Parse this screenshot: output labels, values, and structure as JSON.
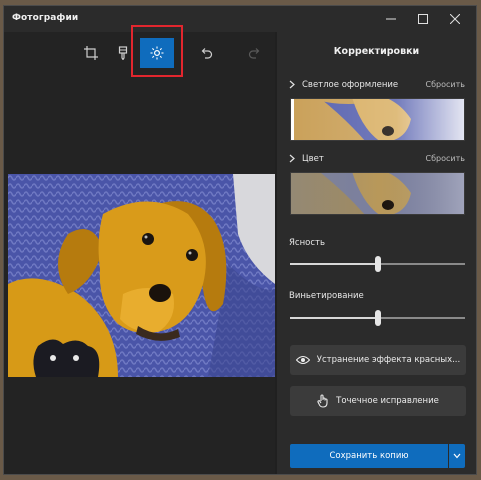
{
  "window": {
    "title": "Фотографии"
  },
  "toolbar": {
    "tools": [
      {
        "name": "crop-icon"
      },
      {
        "name": "filter-brush-icon"
      },
      {
        "name": "brightness-icon",
        "active": true
      },
      {
        "name": "undo-icon"
      },
      {
        "name": "redo-icon",
        "disabled": true
      }
    ]
  },
  "panel": {
    "title": "Корректировки",
    "light": {
      "label": "Светлое оформление",
      "reset": "Сбросить"
    },
    "color": {
      "label": "Цвет",
      "reset": "Сбросить"
    },
    "clarity": {
      "label": "Ясность",
      "value": 0.5
    },
    "vignette": {
      "label": "Виньетирование",
      "value": 0.5
    },
    "red_eye_label": "Устранение эффекта красных...",
    "spot_fix_label": "Точечное исправление",
    "save_label": "Сохранить копию"
  },
  "colors": {
    "accent": "#0f6cbd",
    "highlight": "#e2262e"
  }
}
